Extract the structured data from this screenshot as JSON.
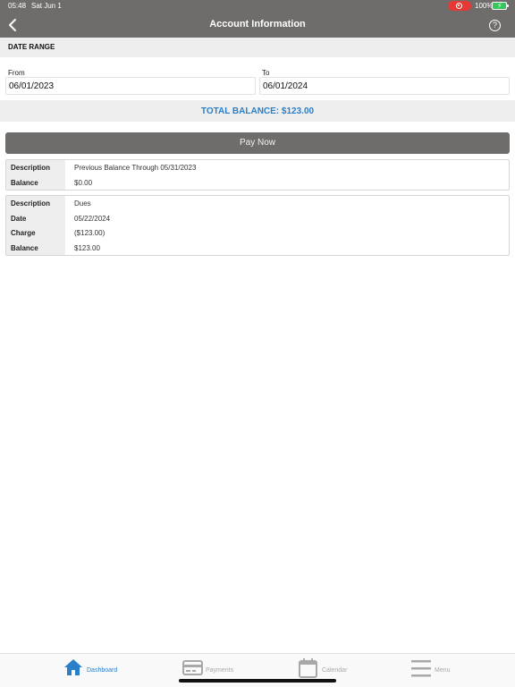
{
  "status_bar": {
    "time": "05:48",
    "date": "Sat Jun 1",
    "battery_percent": "100%"
  },
  "header": {
    "title": "Account Information",
    "back_icon": "chevron-left-icon",
    "help_icon": "question-circle-icon"
  },
  "date_range": {
    "section_label": "DATE RANGE",
    "from": {
      "label": "From",
      "value": "06/01/2023"
    },
    "to": {
      "label": "To",
      "value": "06/01/2024"
    }
  },
  "total_balance": "TOTAL BALANCE: $123.00",
  "pay_now_label": "Pay Now",
  "records": [
    {
      "rows": [
        {
          "key": "Description",
          "value": "Previous Balance Through 05/31/2023"
        },
        {
          "key": "Balance",
          "value": "$0.00"
        }
      ]
    },
    {
      "rows": [
        {
          "key": "Description",
          "value": "Dues"
        },
        {
          "key": "Date",
          "value": "05/22/2024"
        },
        {
          "key": "Charge",
          "value": "($123.00)"
        },
        {
          "key": "Balance",
          "value": "$123.00"
        }
      ]
    }
  ],
  "tab_bar": {
    "tabs": [
      {
        "label": "Dashboard",
        "icon": "home-icon",
        "active": true
      },
      {
        "label": "Payments",
        "icon": "credit-card-icon",
        "active": false
      },
      {
        "label": "Calendar",
        "icon": "calendar-icon",
        "active": false
      },
      {
        "label": "Menu",
        "icon": "hamburger-menu-icon",
        "active": false
      }
    ]
  },
  "colors": {
    "header_bg": "#6f6d6b",
    "accent": "#2a7fc9",
    "section_bg": "#efeeee",
    "inactive_tab": "#a8a8a8",
    "record_indicator": "#e53935",
    "battery": "#34c759"
  }
}
